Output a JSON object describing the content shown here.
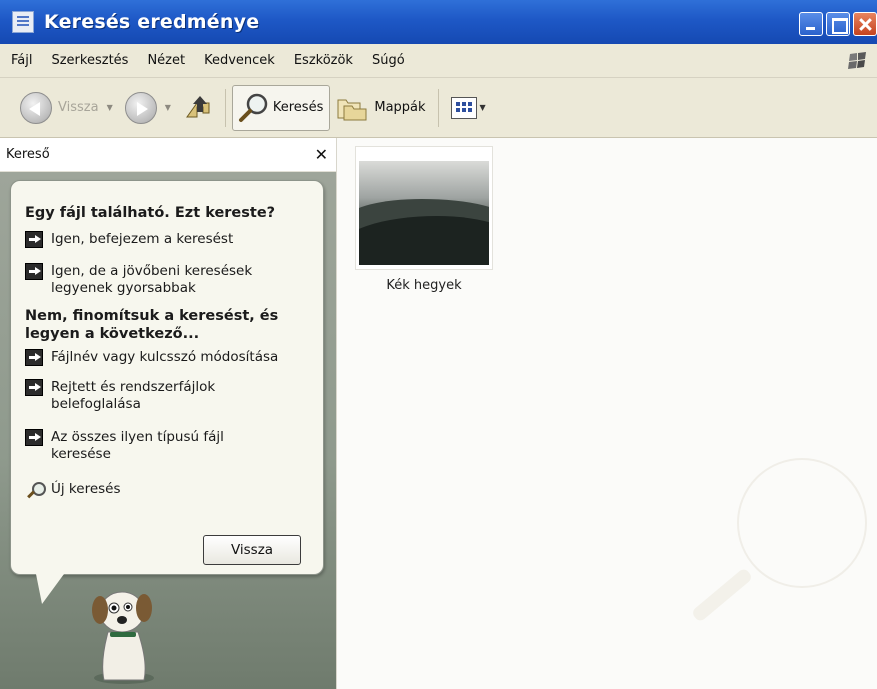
{
  "window": {
    "title": "Keresés eredménye"
  },
  "menu": [
    {
      "label": "Fájl"
    },
    {
      "label": "Szerkesztés"
    },
    {
      "label": "Nézet"
    },
    {
      "label": "Kedvencek"
    },
    {
      "label": "Eszközök"
    },
    {
      "label": "Súgó"
    }
  ],
  "toolbar": {
    "back_label": "Vissza",
    "search_label": "Keresés",
    "folders_label": "Mappák"
  },
  "left_pane": {
    "title": "Kereső",
    "heading1": "Egy fájl található. Ezt kereste?",
    "option_yes": "Igen, befejezem a keresést",
    "option_faster": "Igen, de a jövőbeni keresések legyenek gyorsabbak",
    "heading2": "Nem, finomítsuk a keresést, és legyen a következő...",
    "option_filename": "Fájlnév vagy kulcsszó módosítása",
    "option_hidden": "Rejtett és rendszerfájlok belefoglalása",
    "option_same_type": "Az összes ilyen típusú fájl keresése",
    "new_search": "Új keresés",
    "back_button": "Vissza"
  },
  "results": [
    {
      "name": "Kék hegyek"
    }
  ],
  "colors": {
    "titlebar": "#1e58c6",
    "chrome": "#ece9d8",
    "companion_bg": "#8f9a8d"
  }
}
